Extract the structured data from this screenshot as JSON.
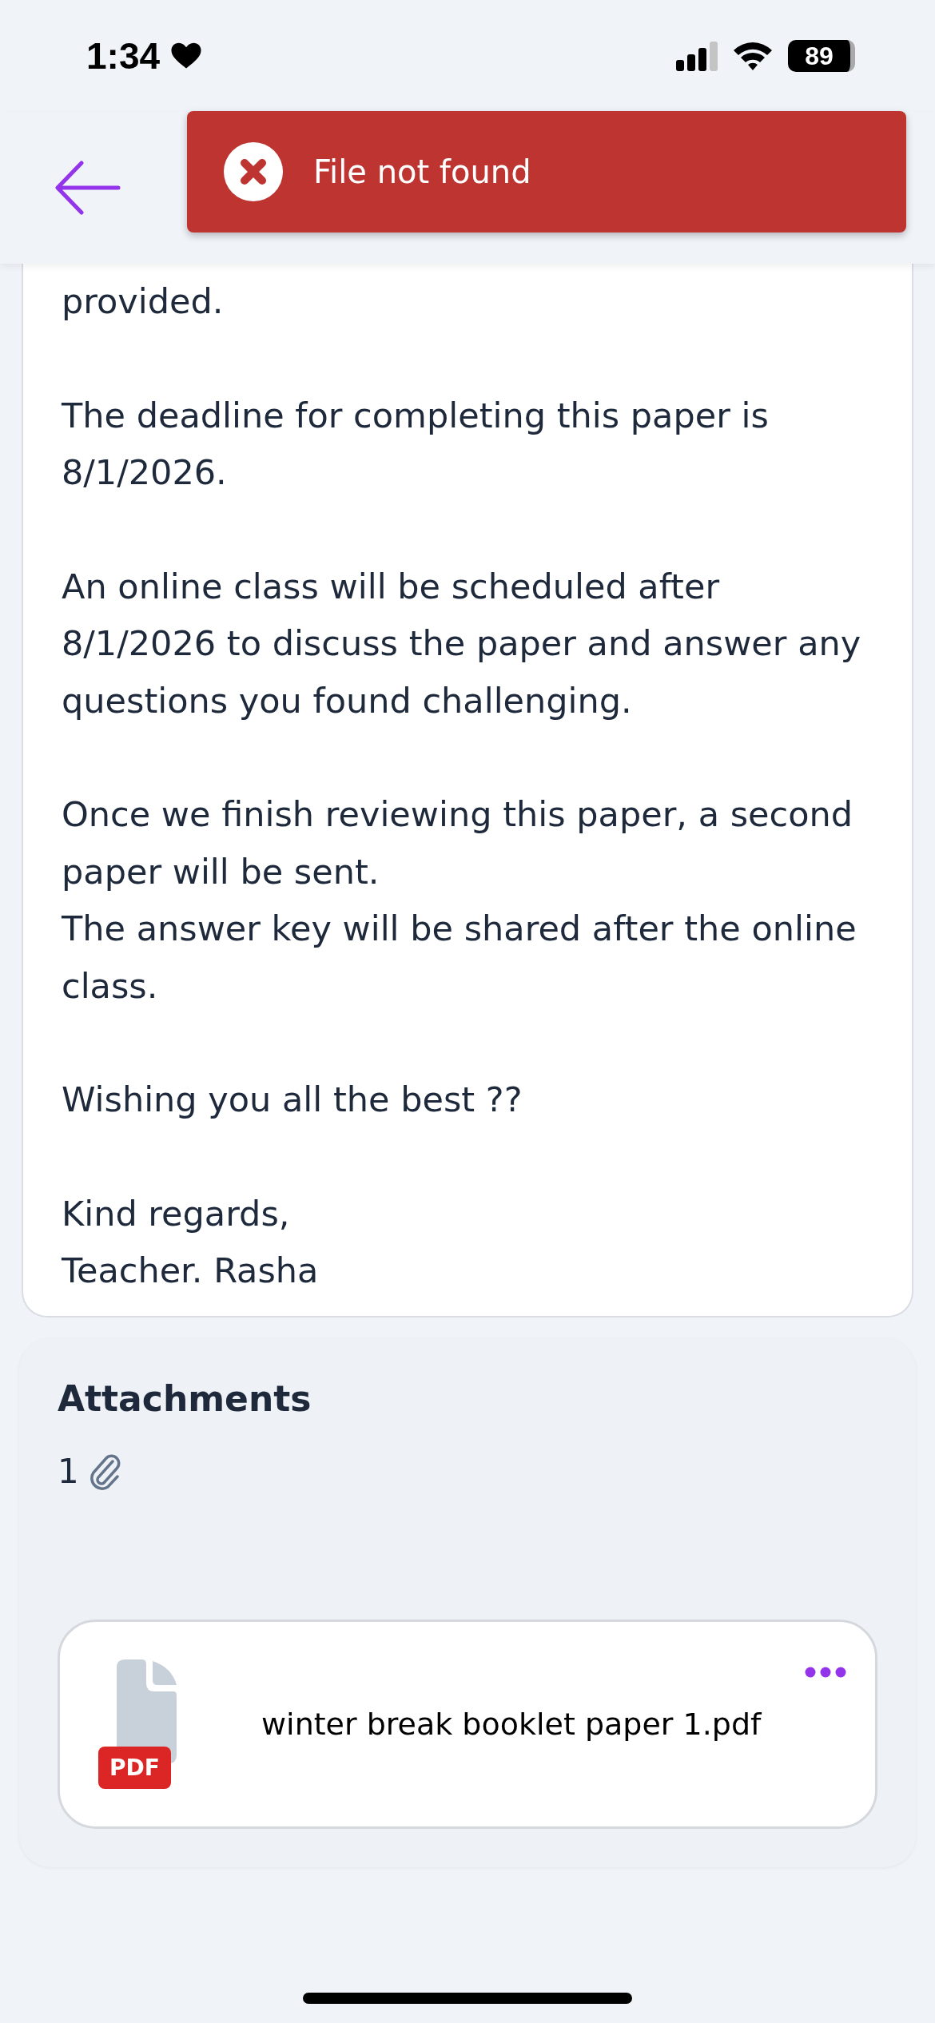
{
  "status_bar": {
    "time": "1:34",
    "battery": "89"
  },
  "toast": {
    "message": "File not found"
  },
  "message": [
    {
      "lines": [
        "provided."
      ]
    },
    {
      "lines": [
        "The deadline for completing this paper is 8/1/2026."
      ]
    },
    {
      "lines": [
        "An online class will be scheduled after 8/1/2026 to discuss the paper and answer any questions you found challenging."
      ]
    },
    {
      "lines": [
        "Once we finish reviewing this paper, a second paper will be sent.",
        "The answer key will be shared after the online class."
      ]
    },
    {
      "lines": [
        "Wishing you all the best ??"
      ]
    },
    {
      "lines": [
        "Kind regards,",
        "Teacher. Rasha"
      ]
    }
  ],
  "attachments": {
    "title": "Attachments",
    "count": "1",
    "files": [
      {
        "name": "winter break booklet paper 1.pdf",
        "type": "PDF"
      }
    ]
  }
}
